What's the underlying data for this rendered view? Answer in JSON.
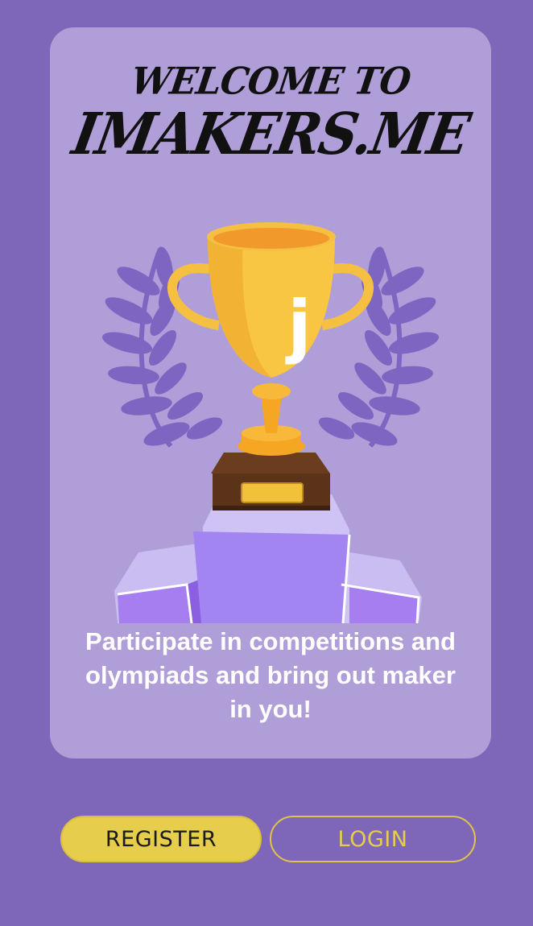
{
  "card": {
    "title_line1": "WELCOME TO",
    "title_line2": "IMAKERS.ME",
    "trophy_emblem_letter": "j",
    "tagline": "Participate in competitions and olympiads and bring out maker in you!"
  },
  "actions": {
    "register_label": "REGISTER",
    "login_label": "LOGIN"
  },
  "colors": {
    "background": "#7e67b8",
    "card": "#b09ed9",
    "accent_yellow": "#e6cd4c",
    "laurel": "#7d66c2"
  },
  "icons": {
    "trophy": "trophy-illustration",
    "laurel": "laurel-wreath-icon",
    "podium": "podium-illustration"
  }
}
